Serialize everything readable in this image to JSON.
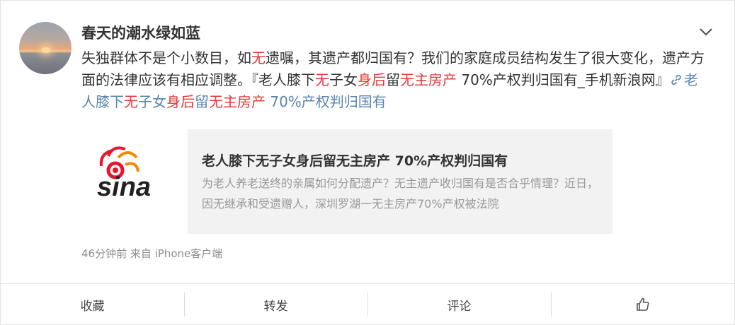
{
  "post": {
    "username": "春天的潮水绿如蓝",
    "text_parts": [
      {
        "t": "失独群体不是个小数目，如"
      },
      {
        "t": "无",
        "c": "red"
      },
      {
        "t": "遗嘱，其遗产都归国有？我们的家庭成员结构发生了很大变化，遗产方面的法律应该有相应调整。『老人膝下"
      },
      {
        "t": "无",
        "c": "red"
      },
      {
        "t": "子女"
      },
      {
        "t": "身后",
        "c": "red"
      },
      {
        "t": "留"
      },
      {
        "t": "无主房产",
        "c": "red"
      },
      {
        "t": " 70%产权判归国有_手机新浪网』"
      }
    ],
    "link_parts": [
      {
        "t": "老人膝下"
      },
      {
        "t": "无",
        "c": "red"
      },
      {
        "t": "子女"
      },
      {
        "t": "身后",
        "c": "red"
      },
      {
        "t": "留"
      },
      {
        "t": "无主房产",
        "c": "red"
      },
      {
        "t": " 70%产权判归国有"
      }
    ],
    "link_icon": "link-icon",
    "share": {
      "logo_text": "sina",
      "title": "老人膝下无子女身后留无主房产 70%产权判归国有",
      "description": "为老人养老送终的亲属如何分配遗产？无主遗产收归国有是否合乎情理？近日，因无继承和受遗赠人，深圳罗湖一无主房产70%产权被法院"
    },
    "meta": "46分钟前 来自 iPhone客户端",
    "menu_icon": "chevron-down-icon"
  },
  "actions": {
    "favorite": "收藏",
    "repost": "转发",
    "comment": "评论",
    "like_icon": "thumbs-up-icon"
  },
  "colors": {
    "highlight": "#e4393c",
    "link": "#5b84b1",
    "meta": "#8c8c8c"
  }
}
